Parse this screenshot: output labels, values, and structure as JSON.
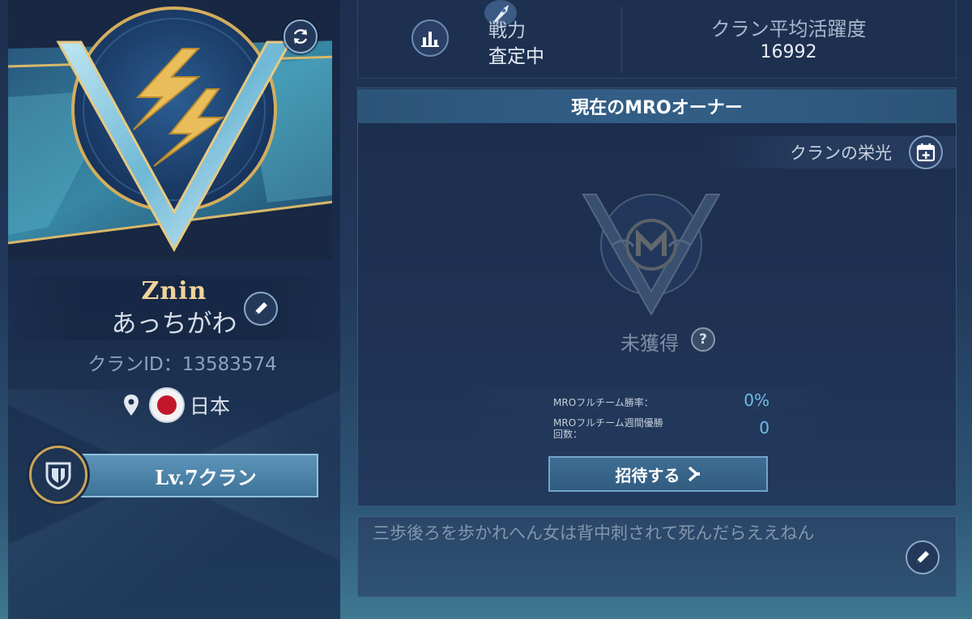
{
  "clan": {
    "name": "Znin",
    "subname": "あっちがわ",
    "id_text": "クランID：13583574",
    "region": "日本",
    "level_label": "Lv.7クラン"
  },
  "stats": {
    "power_label": "戦力",
    "power_value": "査定中",
    "activity_label": "クラン平均活躍度",
    "activity_value": "16992"
  },
  "mro": {
    "title": "現在のMROオーナー",
    "glory_label": "クランの栄光",
    "status": "未獲得",
    "help_symbol": "?",
    "winrate_label": "MROフルチーム勝率：",
    "winrate_value": "0%",
    "weekly_label_line1": "MROフルチーム週間優勝",
    "weekly_label_line2": "回数：",
    "weekly_value": "0",
    "invite_label": "招待する"
  },
  "motto": {
    "text": "三歩後ろを歩かれへん女は背中刺されて死んだらええねん"
  },
  "icons": {
    "refresh": "refresh-icon",
    "edit": "pencil-icon",
    "stats": "bar-chart-icon",
    "glory": "calendar-plus-icon",
    "location": "map-pin-icon",
    "flag": "japan-flag-icon",
    "level": "shield-badge-icon",
    "invite": "chevron-right-icon"
  },
  "colors": {
    "accent_gold": "#f0d39a",
    "accent_blue": "#6fbde6",
    "button_blue": "#3f6d93"
  }
}
